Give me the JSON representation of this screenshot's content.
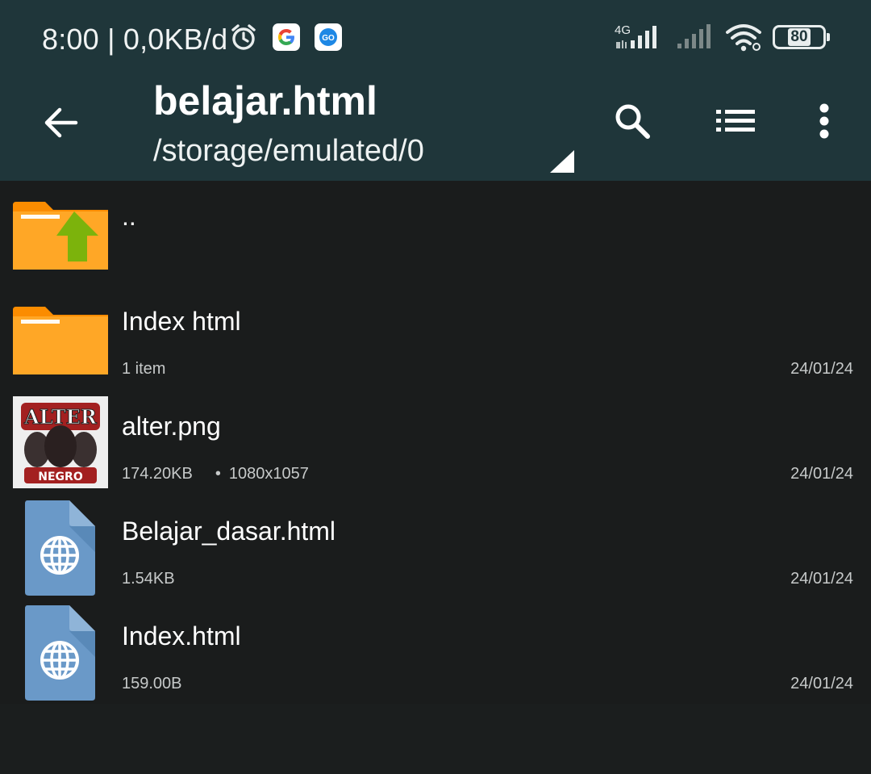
{
  "status_bar": {
    "time": "8:00",
    "separator": "|",
    "network_speed": "0,0KB/d",
    "network_type": "4G",
    "battery": "80",
    "icons": [
      "alarm-icon",
      "google-icon",
      "go-app-icon",
      "signal-icon",
      "signal-icon",
      "wifi-icon",
      "battery-icon"
    ]
  },
  "toolbar": {
    "title": "belajar.html",
    "path": "/storage/emulated/0",
    "icons": [
      "back-arrow-icon",
      "search-icon",
      "list-view-icon",
      "more-vert-icon"
    ]
  },
  "files": [
    {
      "name": "..",
      "meta": "",
      "meta2": "",
      "date": "",
      "icon": "folder-up-icon"
    },
    {
      "name": "Index html",
      "meta": "1 item",
      "meta2": "",
      "date": "24/01/24",
      "icon": "folder-icon"
    },
    {
      "name": "alter.png",
      "meta": "174.20KB",
      "meta2": "1080x1057",
      "date": "24/01/24",
      "icon": "image-thumbnail"
    },
    {
      "name": "Belajar_dasar.html",
      "meta": "1.54KB",
      "meta2": "",
      "date": "24/01/24",
      "icon": "html-file-icon"
    },
    {
      "name": "Index.html",
      "meta": "159.00B",
      "meta2": "",
      "date": "24/01/24",
      "icon": "html-file-icon"
    }
  ],
  "thumbnail_text": {
    "top": "ALTER",
    "bottom": "NEGRO"
  },
  "colors": {
    "header_bg": "#1f363a",
    "list_bg": "#1a1c1c",
    "folder": "#ffa726",
    "folder_tab": "#fb8c00",
    "up_arrow": "#7cb30c",
    "html_file": "#6a99c8"
  }
}
